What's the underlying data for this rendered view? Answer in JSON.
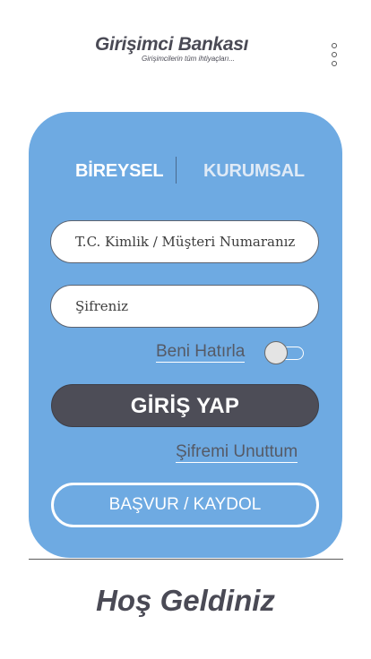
{
  "brand": {
    "name": "Girişimci Bankası",
    "tagline": "Girişimcilerin tüm ihtiyaçları..."
  },
  "header": {
    "menu_icon": "vertical-ellipsis-icon"
  },
  "login_card": {
    "tabs": [
      {
        "label": "BİREYSEL",
        "active": true
      },
      {
        "label": "KURUMSAL",
        "active": false
      }
    ],
    "id_field": {
      "placeholder": "T.C. Kimlik / Müşteri Numaranız",
      "value": ""
    },
    "password_field": {
      "placeholder": "Şifreniz",
      "value": ""
    },
    "remember_me": {
      "label": "Beni Hatırla",
      "checked": false
    },
    "login_button": "GİRİŞ YAP",
    "forgot_password": "Şifremi Unuttum",
    "register_button": "BAŞVUR / KAYDOL"
  },
  "welcome_text": "Hoş Geldiniz",
  "colors": {
    "card_background": "#6eaae2",
    "primary_button": "#4d4d57",
    "brand_text": "#4a4a55",
    "white": "#ffffff"
  }
}
